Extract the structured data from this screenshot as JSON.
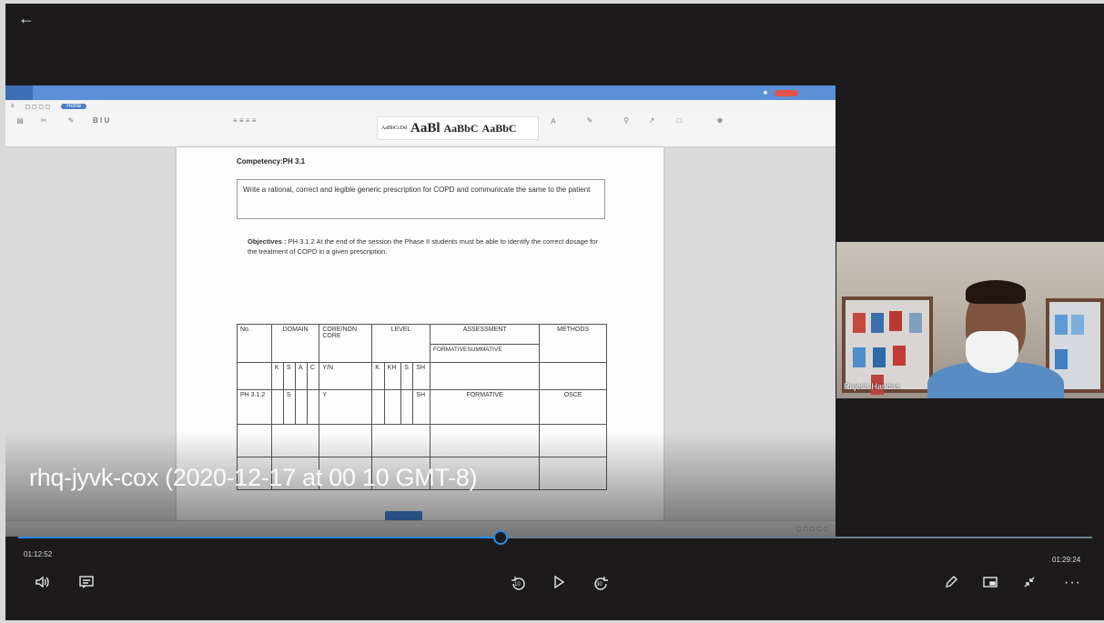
{
  "player": {
    "video_title": "rhq-jyvk-cox (2020-12-17 at 00 10 GMT-8)",
    "time_current": "01:12:52",
    "time_remaining": "01:29:24",
    "progress_fraction": 0.449,
    "controls": {
      "back_icon": "back-arrow-icon",
      "volume_icon": "volume-icon",
      "captions_icon": "captions-icon",
      "rewind_label": "10",
      "forward_label": "30",
      "play_icon": "play-icon",
      "pen_icon": "pen-icon",
      "miniplayer_icon": "miniplayer-icon",
      "exit_fullscreen_icon": "collapse-icon",
      "more_icon": "more-icon",
      "more_glyph": "···"
    },
    "accent_color": "#2a8be8"
  },
  "shared_screen": {
    "menu_active": "Home",
    "document": {
      "competency": "Competency:PH 3.1",
      "outcome": "Write a rational, correct and legible generic prescription for COPD and communicate the same to the patient",
      "objectives_label": "Objectives :",
      "objectives_text": "PH 3.1.2 At the end of the session the Phase II students must be able to identify the correct dosage for the treatment of COPD in a given prescription.",
      "table": {
        "headers": {
          "no": "No.",
          "domain": "DOMAIN",
          "core": "CORE/NON CORE",
          "level": "LEVEL",
          "assessment": "ASSESSMENT",
          "methods": "METHODS",
          "assessment_sub": "FORMATIVESUMMATIVE"
        },
        "subheaders": {
          "k": "K",
          "s": "S",
          "a": "A",
          "c": "C",
          "yn": "Y/N",
          "lk": "K",
          "kh": "KH",
          "ls": "S",
          "sh": "SH"
        },
        "row": {
          "no": "PH 3.1.2",
          "s": "S",
          "core": "Y",
          "level": "SH",
          "assessment": "FORMATIVE",
          "method": "OSCE"
        }
      }
    }
  },
  "webcam": {
    "name": "Rajesh Handas"
  }
}
